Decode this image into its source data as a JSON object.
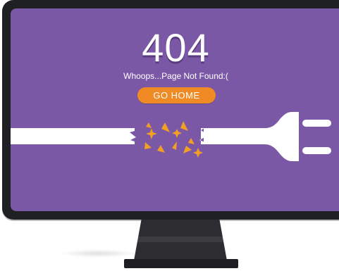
{
  "error": {
    "code": "404",
    "message": "Whoops...Page Not Found:(",
    "button_label": "GO HOME"
  },
  "colors": {
    "screen_bg": "#7b58a6",
    "button_bg": "#f08a24",
    "monitor_frame": "#1f2024",
    "spark": "#f2a024"
  },
  "illustration": {
    "cable_icon": "broken-cable-icon",
    "plug_icon": "power-plug-icon",
    "spark_icon": "spark-icon"
  }
}
